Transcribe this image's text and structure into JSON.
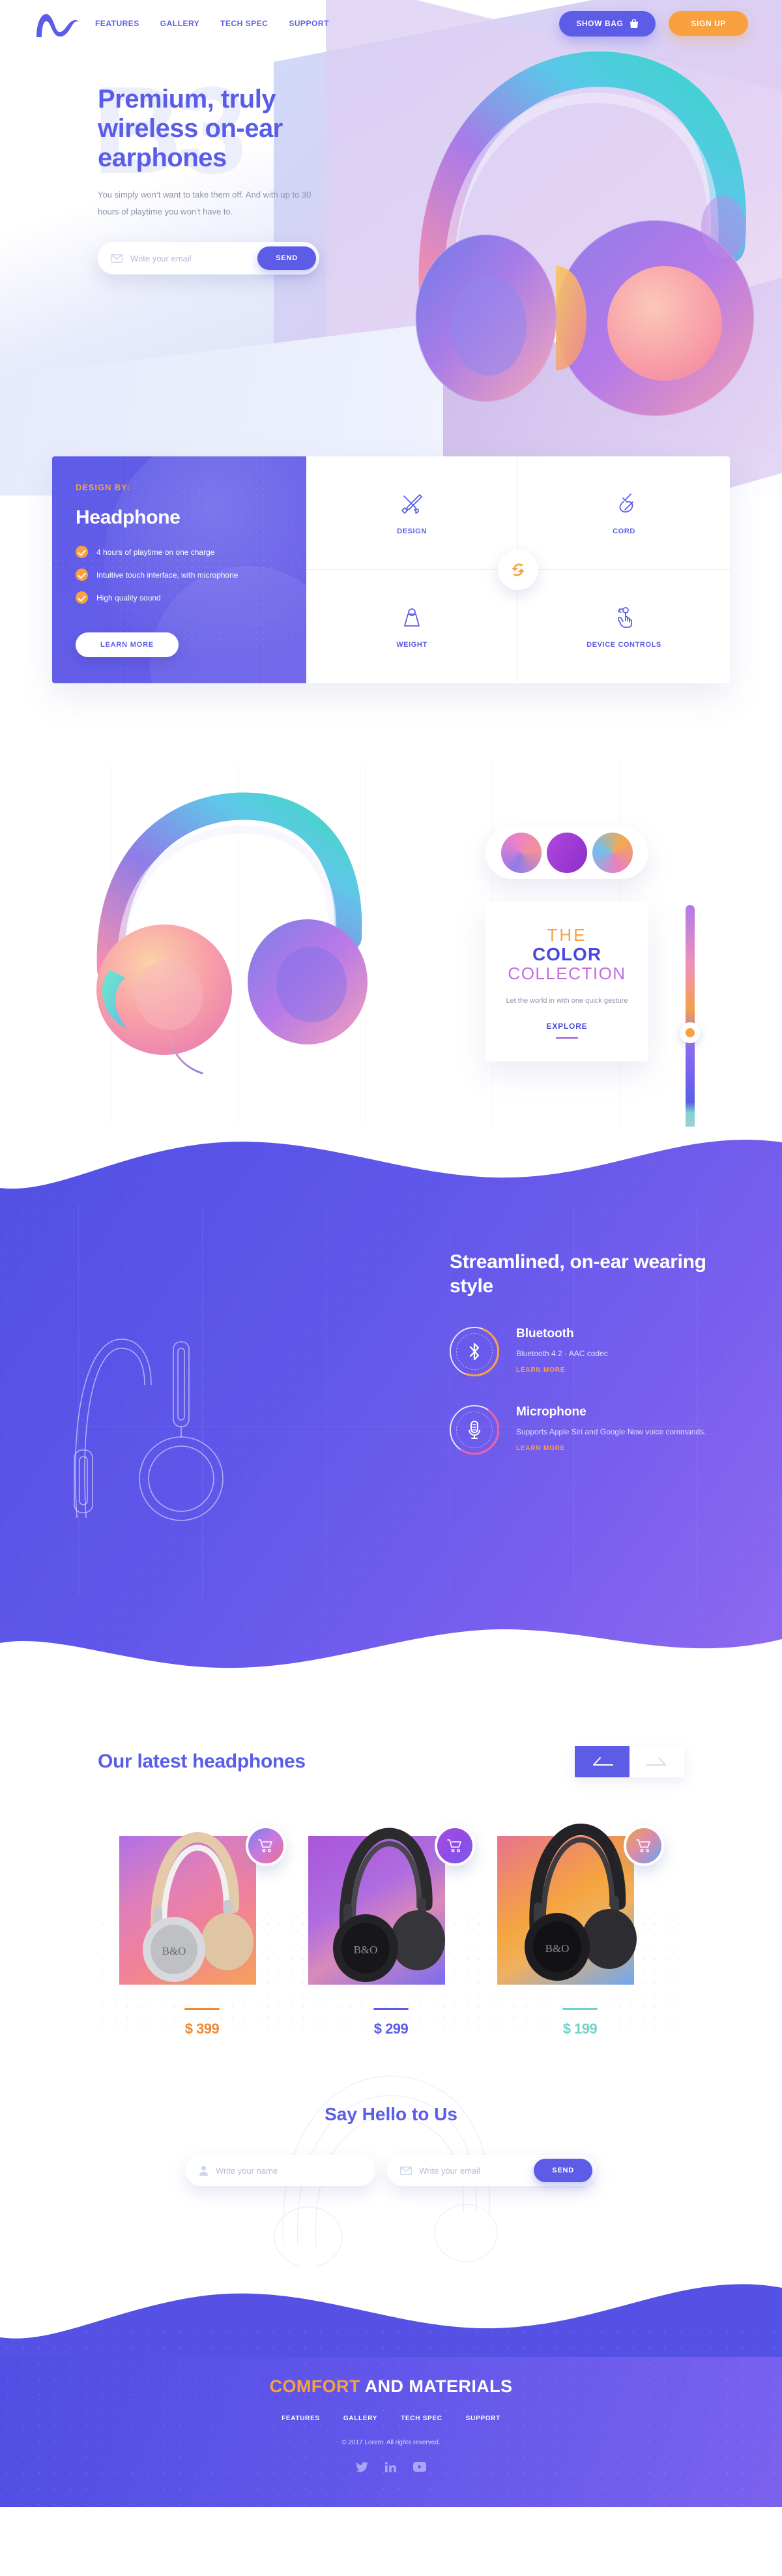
{
  "brand": {
    "logo_icon": "wave-logo-icon"
  },
  "nav": {
    "links": [
      "FEATURES",
      "GALLERY",
      "TECH SPEC",
      "SUPPORT"
    ],
    "show_bag": "SHOW BAG",
    "bag_icon": "shopping-bag-icon",
    "sign_up": "SIGN UP"
  },
  "hero": {
    "ghost_text": "B3",
    "title": "Premium, truly wireless on-ear earphones",
    "subtitle": "You simply won’t want to take them off. And with up to 30 hours of playtime you won’t have to.",
    "email_placeholder": "Write your email",
    "email_value": "",
    "email_icon": "envelope-icon",
    "send_label": "SEND"
  },
  "design": {
    "eyebrow": "DESIGN BY:",
    "heading": "Headphone",
    "features": [
      "4 hours of playtime on one charge",
      "Intuitive touch interface, with microphone",
      "High quality sound"
    ],
    "learn_more": "LEARN MORE",
    "sync_icon": "sync-refresh-icon",
    "cells": [
      {
        "label": "DESIGN",
        "icon": "pen-brush-icon"
      },
      {
        "label": "CORD",
        "icon": "cord-icon"
      },
      {
        "label": "WEIGHT",
        "icon": "weight-icon"
      },
      {
        "label": "DEVICE CONTROLS",
        "icon": "touch-hand-icon"
      }
    ]
  },
  "color_collection": {
    "swatches": [
      "#8f7ce8",
      "#a64de0",
      "#f6a94e"
    ],
    "the": "THE",
    "color": "COLOR",
    "collection": "COLLECTION",
    "description": "Let the world in with one quick gesture",
    "explore": "EXPLORE",
    "slider_knob_color": "#f9a03f"
  },
  "streamlined": {
    "title": "Streamlined, on-ear wearing style",
    "items": [
      {
        "icon": "bluetooth-icon",
        "title": "Bluetooth",
        "description": "Bluetooth 4.2 · AAC codec",
        "learn_more": "LEARN MORE",
        "accent": "#f9a03f"
      },
      {
        "icon": "microphone-icon",
        "title": "Microphone",
        "description": "Supports Apple Siri and Google Now voice commands.",
        "learn_more": "LEARN MORE",
        "accent": "#ef5fa0"
      }
    ]
  },
  "products": {
    "title": "Our latest headphones",
    "prev_icon": "arrow-left-icon",
    "next_icon": "arrow-right-icon",
    "cart_icon": "shopping-cart-icon",
    "items": [
      {
        "price": "$ 399",
        "color": "#f08a33",
        "rule_color": "#f08a33",
        "bg_a": "#b070e8",
        "bg_b": "#f0809a",
        "bg_c": "#f5a25a",
        "cart_a": "#7b7cf0",
        "cart_b": "#f06f8a"
      },
      {
        "price": "$ 299",
        "color": "#5c5ce6",
        "rule_color": "#5c5ce6",
        "bg_a": "#a855d8",
        "bg_b": "#7b6cee",
        "bg_c": "#d98ab8",
        "cart_a": "#a24ee0",
        "cart_b": "#7b5ce8"
      },
      {
        "price": "$ 199",
        "color": "#6fd4c8",
        "rule_color": "#6fd4c8",
        "bg_a": "#e8738e",
        "bg_b": "#f5a53e",
        "bg_c": "#6fa8f0",
        "cart_a": "#f0a24e",
        "cart_b": "#5fa8f0"
      }
    ]
  },
  "contact": {
    "title": "Say Hello to Us",
    "name_placeholder": "Write your name",
    "name_value": "",
    "name_icon": "user-icon",
    "email_placeholder": "Write your email",
    "email_value": "",
    "email_icon": "envelope-icon",
    "send_label": "SEND"
  },
  "footer": {
    "head_highlight": "COMFORT",
    "head_rest": " AND MATERIALS",
    "links": [
      "FEATURES",
      "GALLERY",
      "TECH SPEC",
      "SUPPORT"
    ],
    "copyright": "© 2017 Lorem. All rights reserved.",
    "social": [
      {
        "name": "twitter-icon",
        "glyph": "✓"
      },
      {
        "name": "linkedin-icon",
        "glyph": "in"
      },
      {
        "name": "youtube-icon",
        "glyph": "▶"
      }
    ]
  },
  "colors": {
    "primary": "#5c5ce6",
    "accent": "#f9a03f",
    "text_muted": "#8e93ad"
  }
}
